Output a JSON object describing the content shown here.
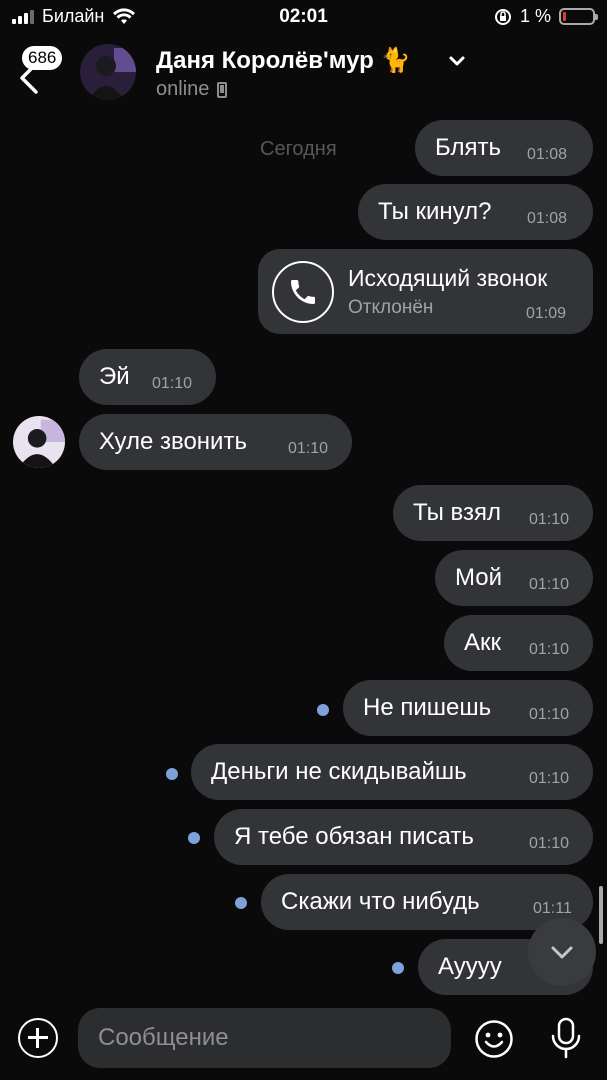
{
  "status_bar": {
    "carrier": "Билайн",
    "time": "02:01",
    "battery": "1 %",
    "icons": [
      "signal-icon",
      "wifi-icon",
      "rotation-lock-icon",
      "battery-icon"
    ]
  },
  "header": {
    "unread_count": "686",
    "name": "Даня Королёв'мур 🐈",
    "status": "online",
    "icons": [
      "back-arrow-icon",
      "chevron-down-icon",
      "mobile-phone-icon"
    ]
  },
  "chat": {
    "date_separator": "Сегодня",
    "messages": [
      {
        "dir": "out",
        "text": "Блять",
        "time": "01:08"
      },
      {
        "dir": "out",
        "text": "Ты кинул?",
        "time": "01:08"
      },
      {
        "dir": "out",
        "type": "call",
        "title": "Исходящий звонок",
        "subtitle": "Отклонён",
        "time": "01:09"
      },
      {
        "dir": "in",
        "text": "Эй",
        "time": "01:10"
      },
      {
        "dir": "in",
        "text": "Хуле звонить",
        "time": "01:10"
      },
      {
        "dir": "out",
        "text": "Ты взял",
        "time": "01:10"
      },
      {
        "dir": "out",
        "text": "Мой",
        "time": "01:10"
      },
      {
        "dir": "out",
        "text": "Акк",
        "time": "01:10"
      },
      {
        "dir": "out",
        "text": "Не пишешь",
        "time": "01:10",
        "unread": true
      },
      {
        "dir": "out",
        "text": "Деньги не скидывайшь",
        "time": "01:10",
        "unread": true
      },
      {
        "dir": "out",
        "text": "Я тебе обязан писать",
        "time": "01:10",
        "unread": true
      },
      {
        "dir": "out",
        "text": "Скажи что нибудь",
        "time": "01:11",
        "unread": true
      },
      {
        "dir": "out",
        "text": "Ауууу",
        "time": "",
        "unread": true
      }
    ]
  },
  "composer": {
    "placeholder": "Сообщение",
    "icons": [
      "plus-icon",
      "emoji-icon",
      "microphone-icon",
      "chevron-down-icon"
    ]
  },
  "colors": {
    "background": "#0a0a0a",
    "bubble": "#333437",
    "unread_dot": "#7ea1d9",
    "secondary_text": "#a0a2a6"
  }
}
